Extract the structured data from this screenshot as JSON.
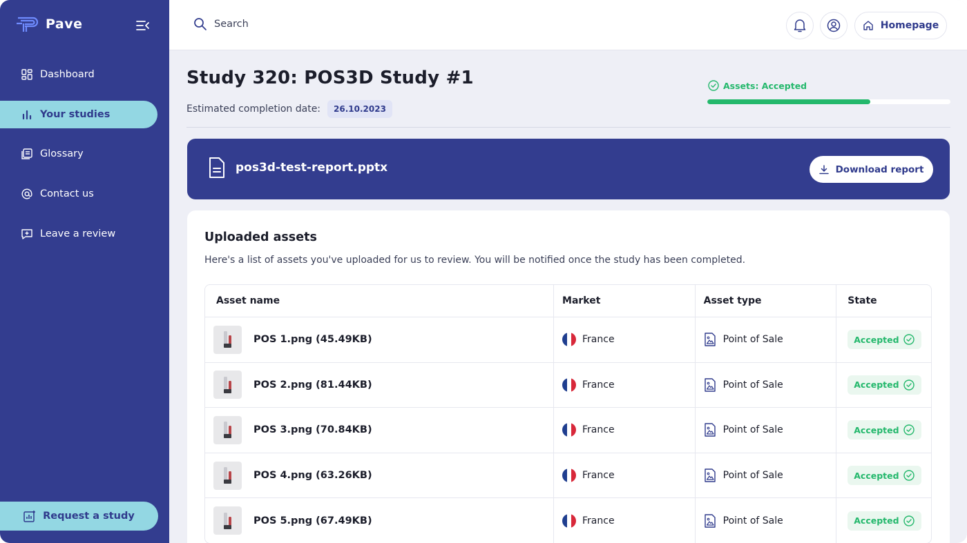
{
  "app": {
    "name": "Pave"
  },
  "sidebar": {
    "items": [
      {
        "label": "Dashboard",
        "icon": "dashboard-icon",
        "active": false
      },
      {
        "label": "Your studies",
        "icon": "bar-chart-icon",
        "active": true
      },
      {
        "label": "Glossary",
        "icon": "book-icon",
        "active": false
      },
      {
        "label": "Contact us",
        "icon": "at-icon",
        "active": false
      },
      {
        "label": "Leave a review",
        "icon": "review-icon",
        "active": false
      }
    ],
    "request_label": "Request a study"
  },
  "topbar": {
    "search_placeholder": "Search",
    "homepage_label": "Homepage"
  },
  "study": {
    "title": "Study 320: POS3D Study #1",
    "est_label": "Estimated completion date:",
    "est_date": "26.10.2023",
    "status": "Assets: Accepted",
    "progress": 0.67
  },
  "report": {
    "filename": "pos3d-test-report.pptx",
    "download_label": "Download report"
  },
  "assets": {
    "title": "Uploaded assets",
    "subtitle": "Here's a list of assets you've uploaded for us to review. You will be notified once the study has been completed.",
    "columns": [
      "Asset name",
      "Market",
      "Asset type",
      "State"
    ],
    "rows": [
      {
        "name": "POS 1.png (45.49KB)",
        "market": "France",
        "type": "Point of Sale",
        "state": "Accepted"
      },
      {
        "name": "POS 2.png (81.44KB)",
        "market": "France",
        "type": "Point of Sale",
        "state": "Accepted"
      },
      {
        "name": "POS 3.png (70.84KB)",
        "market": "France",
        "type": "Point of Sale",
        "state": "Accepted"
      },
      {
        "name": "POS 4.png (63.26KB)",
        "market": "France",
        "type": "Point of Sale",
        "state": "Accepted"
      },
      {
        "name": "POS 5.png (67.49KB)",
        "market": "France",
        "type": "Point of Sale",
        "state": "Accepted"
      }
    ]
  },
  "colors": {
    "sidebar": "#333d8f",
    "accent": "#93d7e3",
    "success": "#24b86c"
  }
}
